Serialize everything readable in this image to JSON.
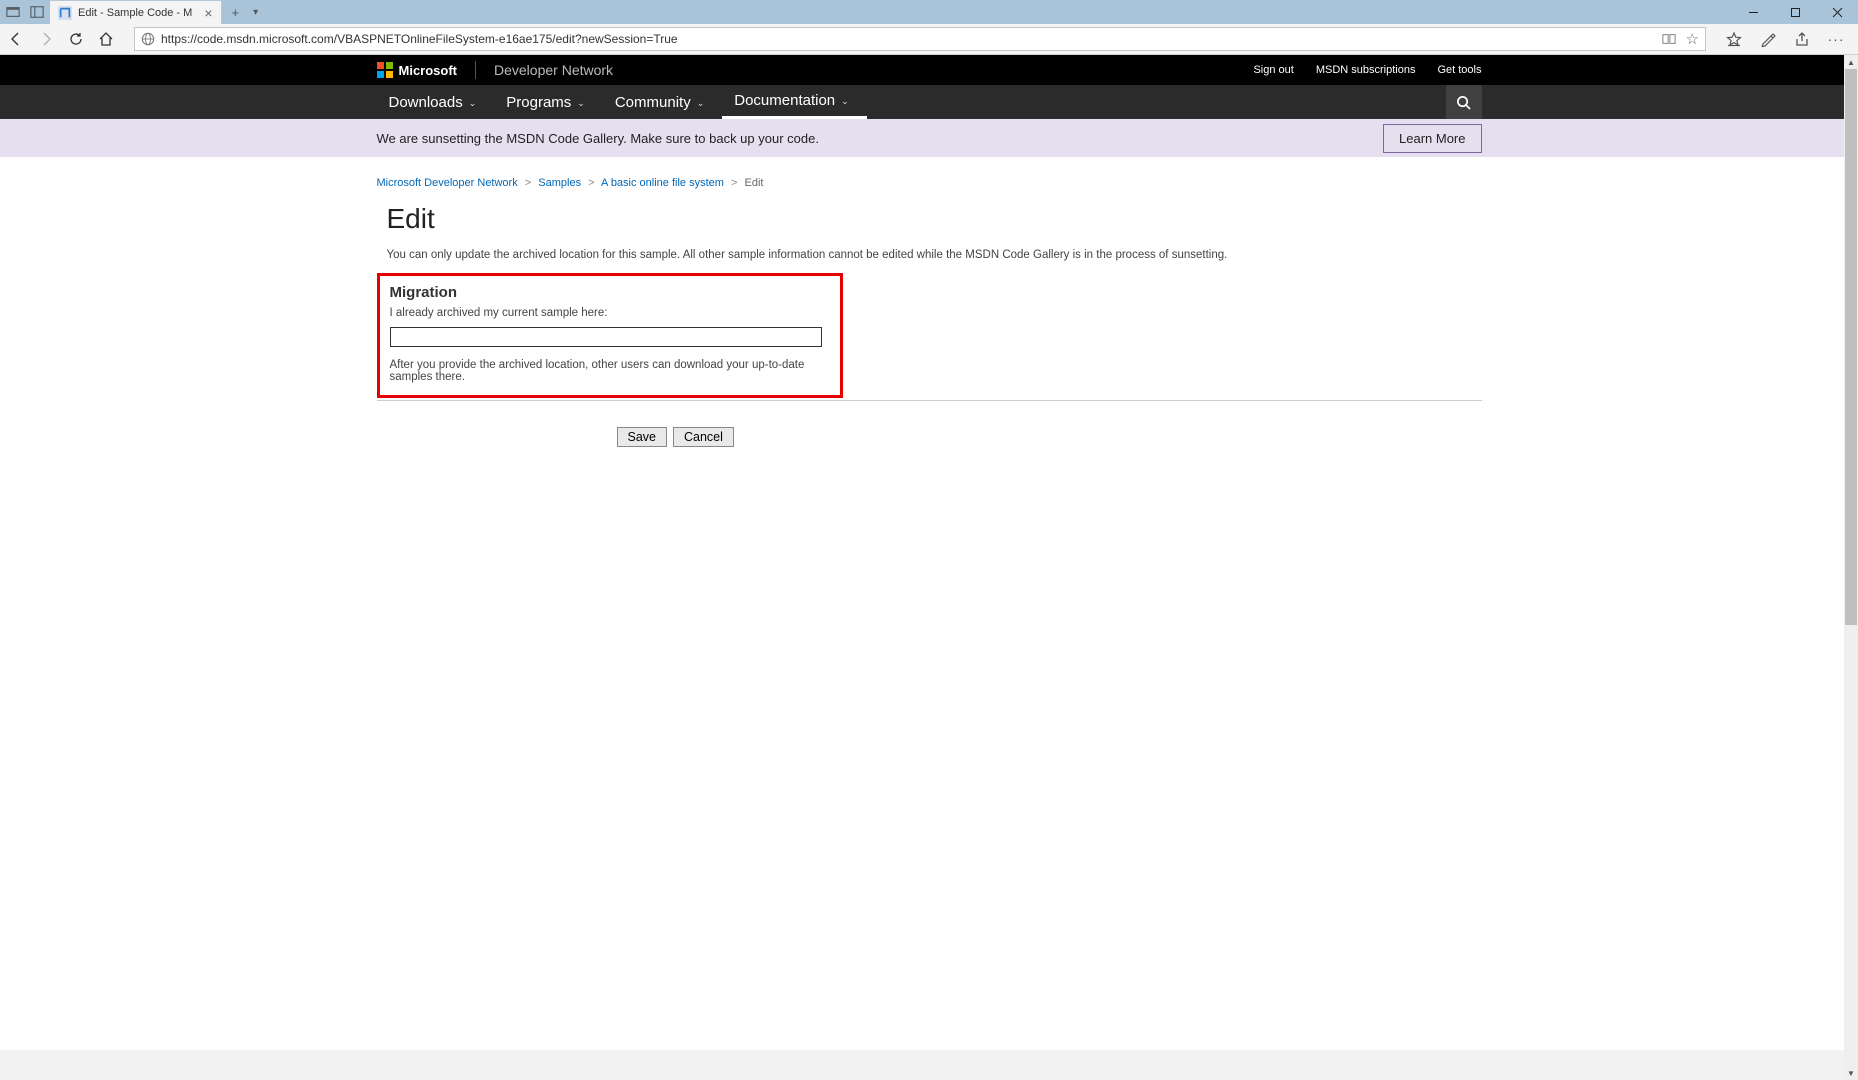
{
  "browser": {
    "tab_title": "Edit - Sample Code - M",
    "url": "https://code.msdn.microsoft.com/VBASPNETOnlineFileSystem-e16ae175/edit?newSession=True"
  },
  "header": {
    "ms_label": "Microsoft",
    "brand": "Developer Network",
    "links": {
      "signout": "Sign out",
      "subs": "MSDN subscriptions",
      "tools": "Get tools"
    }
  },
  "nav": {
    "items": [
      "Downloads",
      "Programs",
      "Community",
      "Documentation"
    ],
    "active_index": 3
  },
  "banner": {
    "text": "We are sunsetting the MSDN Code Gallery. Make sure to back up your code.",
    "button": "Learn More"
  },
  "breadcrumb": {
    "items": [
      {
        "label": "Microsoft Developer Network",
        "link": true
      },
      {
        "label": "Samples",
        "link": true
      },
      {
        "label": "A basic online file system",
        "link": true
      },
      {
        "label": "Edit",
        "link": false
      }
    ]
  },
  "page": {
    "title": "Edit",
    "note": "You can only update the archived location for this sample. All other sample information cannot be edited while the MSDN Code Gallery is in the process of sunsetting."
  },
  "migration": {
    "heading": "Migration",
    "label": "I already archived my current sample here:",
    "value": "",
    "hint": "After you provide the archived location, other users can download your up-to-date samples there."
  },
  "buttons": {
    "save": "Save",
    "cancel": "Cancel"
  }
}
